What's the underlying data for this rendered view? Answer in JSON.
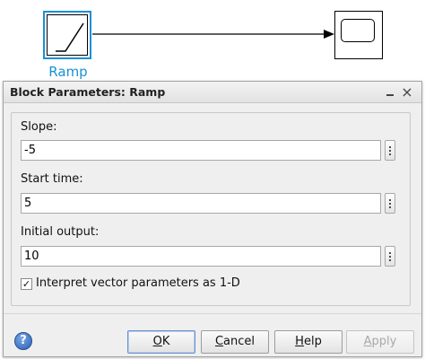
{
  "canvas": {
    "ramp_block_label": "Ramp",
    "icons": {
      "ramp": "ramp-icon",
      "scope": "scope-icon"
    }
  },
  "dialog": {
    "title": "Block Parameters: Ramp",
    "fields": [
      {
        "label": "Slope:",
        "value": "-5"
      },
      {
        "label": "Start time:",
        "value": "5"
      },
      {
        "label": "Initial output:",
        "value": "10"
      }
    ],
    "checkbox": {
      "label": "Interpret vector parameters as 1-D",
      "checked": true,
      "mark": "✓"
    },
    "buttons": {
      "ok": {
        "mnemonic": "O",
        "rest": "K"
      },
      "cancel": {
        "mnemonic": "C",
        "rest": "ancel"
      },
      "help": {
        "mnemonic": "H",
        "rest": "elp"
      },
      "apply": {
        "mnemonic": "A",
        "rest": "pply"
      }
    },
    "help_icon_glyph": "?",
    "close_glyph": "×"
  },
  "colors": {
    "selection_blue": "#1a8fd6",
    "dialog_bg": "#efefef"
  }
}
